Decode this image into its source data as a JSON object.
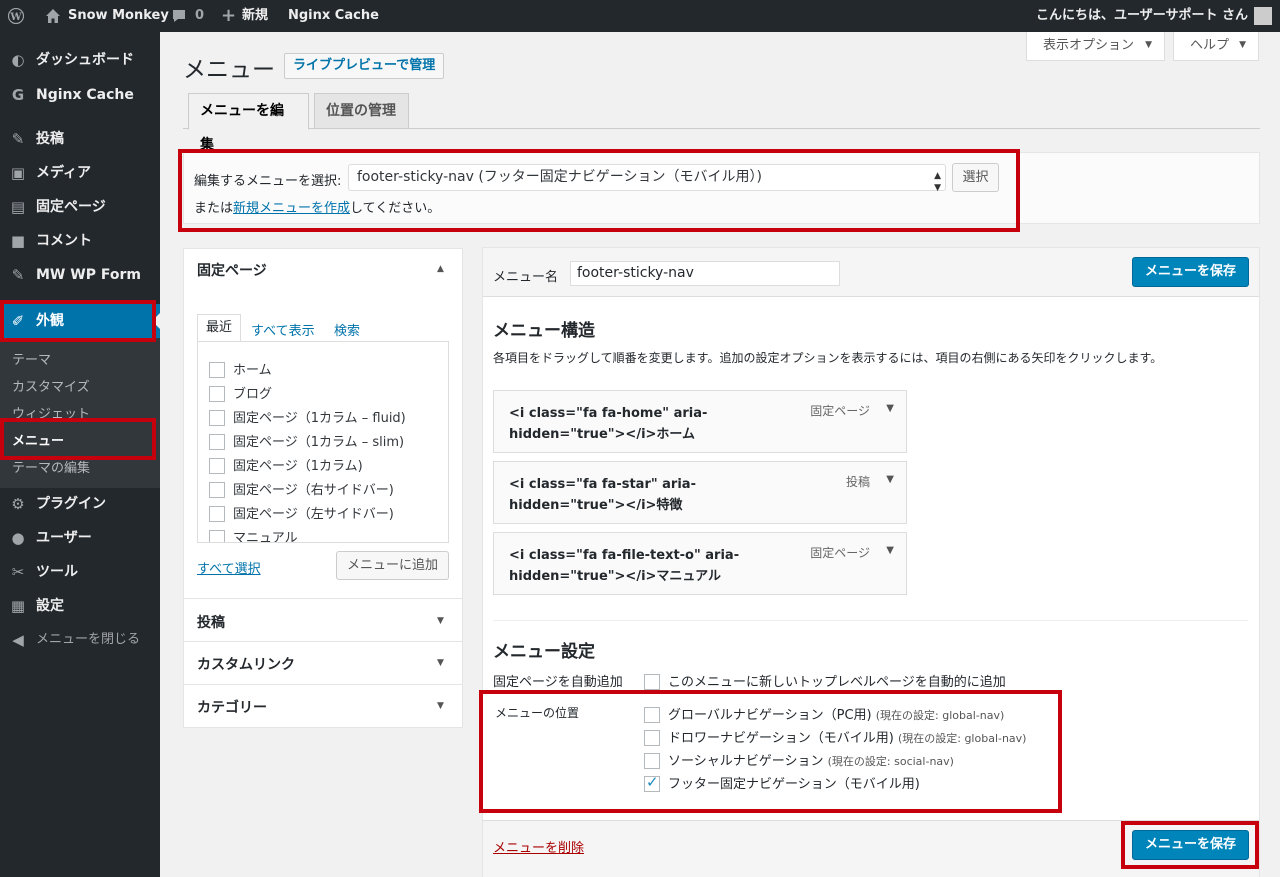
{
  "admin_bar": {
    "site_name": "Snow Monkey",
    "comments_count": "0",
    "new_label": "新規",
    "cache_label": "Nginx Cache",
    "greeting": "こんにちは、ユーザーサポート さん"
  },
  "sidebar": {
    "items": [
      {
        "label": "ダッシュボード",
        "icon": "dashboard-icon"
      },
      {
        "label": "Nginx Cache",
        "icon": "nginx-cache-icon"
      },
      {
        "label": "投稿",
        "icon": "pin-icon"
      },
      {
        "label": "メディア",
        "icon": "media-icon"
      },
      {
        "label": "固定ページ",
        "icon": "page-icon"
      },
      {
        "label": "コメント",
        "icon": "comment-icon"
      },
      {
        "label": "MW WP Form",
        "icon": "pin-icon"
      },
      {
        "label": "外観",
        "icon": "appearance-icon"
      },
      {
        "label": "プラグイン",
        "icon": "plugin-icon"
      },
      {
        "label": "ユーザー",
        "icon": "user-icon"
      },
      {
        "label": "ツール",
        "icon": "wrench-icon"
      },
      {
        "label": "設定",
        "icon": "settings-icon"
      },
      {
        "label": "メニューを閉じる",
        "icon": "collapse-icon"
      }
    ],
    "submenu": [
      "テーマ",
      "カスタマイズ",
      "ウィジェット",
      "メニュー",
      "テーマの編集"
    ]
  },
  "screen_options": {
    "options": "表示オプション",
    "help": "ヘルプ"
  },
  "page": {
    "title": "メニュー",
    "live_preview": "ライブプレビューで管理",
    "tabs": [
      "メニューを編集",
      "位置の管理"
    ]
  },
  "select_menu": {
    "label": "編集するメニューを選択:",
    "selected": "footer-sticky-nav (フッター固定ナビゲーション（モバイル用）)",
    "button": "選択",
    "note_prefix": "または",
    "note_link": "新規メニューを作成",
    "note_suffix": "してください。"
  },
  "accordion": {
    "pages_title": "固定ページ",
    "inner_tabs": [
      "最近",
      "すべて表示",
      "検索"
    ],
    "pages": [
      "ホーム",
      "ブログ",
      "固定ページ（1カラム – fluid)",
      "固定ページ（1カラム – slim)",
      "固定ページ（1カラム)",
      "固定ページ（右サイドバー)",
      "固定ページ（左サイドバー)",
      "マニュアル"
    ],
    "select_all": "すべて選択",
    "add_to_menu": "メニューに追加",
    "sections": [
      "投稿",
      "カスタムリンク",
      "カテゴリー"
    ]
  },
  "menu_edit": {
    "name_label": "メニュー名",
    "name_value": "footer-sticky-nav",
    "save": "メニューを保存",
    "structure_title": "メニュー構造",
    "structure_instructions": "各項目をドラッグして順番を変更します。追加の設定オプションを表示するには、項目の右側にある矢印をクリックします。",
    "items": [
      {
        "title": "<i class=\"fa fa-home\" aria-hidden=\"true\"></i>ホーム",
        "type": "固定ページ"
      },
      {
        "title": "<i class=\"fa fa-star\" aria-hidden=\"true\"></i>特徴",
        "type": "投稿"
      },
      {
        "title": "<i class=\"fa fa-file-text-o\" aria-hidden=\"true\"></i>マニュアル",
        "type": "固定ページ"
      }
    ],
    "settings_title": "メニュー設定",
    "auto_add_label": "固定ページを自動追加",
    "auto_add_option": "このメニューに新しいトップレベルページを自動的に追加",
    "locations_label": "メニューの位置",
    "locations": [
      {
        "label": "グローバルナビゲーション（PC用)",
        "note": "(現在の設定: global-nav)",
        "checked": false
      },
      {
        "label": "ドロワーナビゲーション（モバイル用)",
        "note": "(現在の設定: global-nav)",
        "checked": false
      },
      {
        "label": "ソーシャルナビゲーション",
        "note": "(現在の設定: social-nav)",
        "checked": false
      },
      {
        "label": "フッター固定ナビゲーション（モバイル用)",
        "note": "",
        "checked": true
      }
    ],
    "delete": "メニューを削除"
  }
}
